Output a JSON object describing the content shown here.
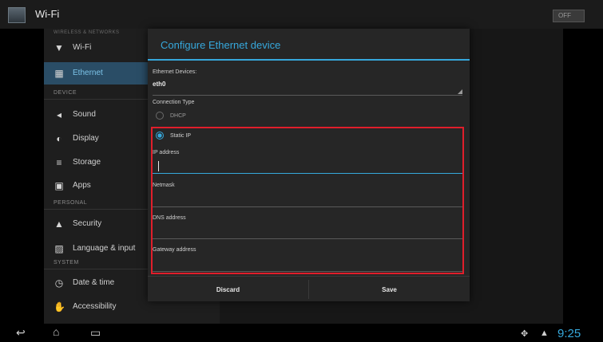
{
  "action_bar": {
    "title": "Wi-Fi",
    "toggle_label": "OFF"
  },
  "settings": {
    "top_category": "WIRELESS & NETWORKS",
    "wireless_items": [
      {
        "icon": "wifi-icon",
        "label": "Wi-Fi"
      },
      {
        "icon": "ethernet-icon",
        "label": "Ethernet"
      }
    ],
    "device_header": "DEVICE",
    "device_items": [
      {
        "icon": "sound-icon",
        "label": "Sound"
      },
      {
        "icon": "display-icon",
        "label": "Display"
      },
      {
        "icon": "storage-icon",
        "label": "Storage"
      },
      {
        "icon": "apps-icon",
        "label": "Apps"
      }
    ],
    "personal_header": "PERSONAL",
    "personal_items": [
      {
        "icon": "lock-icon",
        "label": "Security"
      },
      {
        "icon": "language-icon",
        "label": "Language & input"
      }
    ],
    "system_header": "SYSTEM",
    "system_items": [
      {
        "icon": "clock-icon",
        "label": "Date & time"
      },
      {
        "icon": "accessibility-icon",
        "label": "Accessibility"
      }
    ]
  },
  "dialog": {
    "title": "Configure Ethernet device",
    "devices_label": "Ethernet Devices:",
    "device_value": "eth0",
    "connection_type_label": "Connection Type",
    "dhcp_label": "DHCP",
    "static_label": "Static IP",
    "selected_type": "Static IP",
    "ip_label": "IP address",
    "ip_value": "",
    "netmask_label": "Netmask",
    "netmask_value": "",
    "dns_label": "DNS address",
    "dns_value": "",
    "gateway_label": "Gateway address",
    "gateway_value": "",
    "discard_label": "Discard",
    "save_label": "Save"
  },
  "status_bar": {
    "time": "9:25"
  },
  "colors": {
    "accent": "#36a8dc",
    "highlight_box": "#e01e2b"
  }
}
